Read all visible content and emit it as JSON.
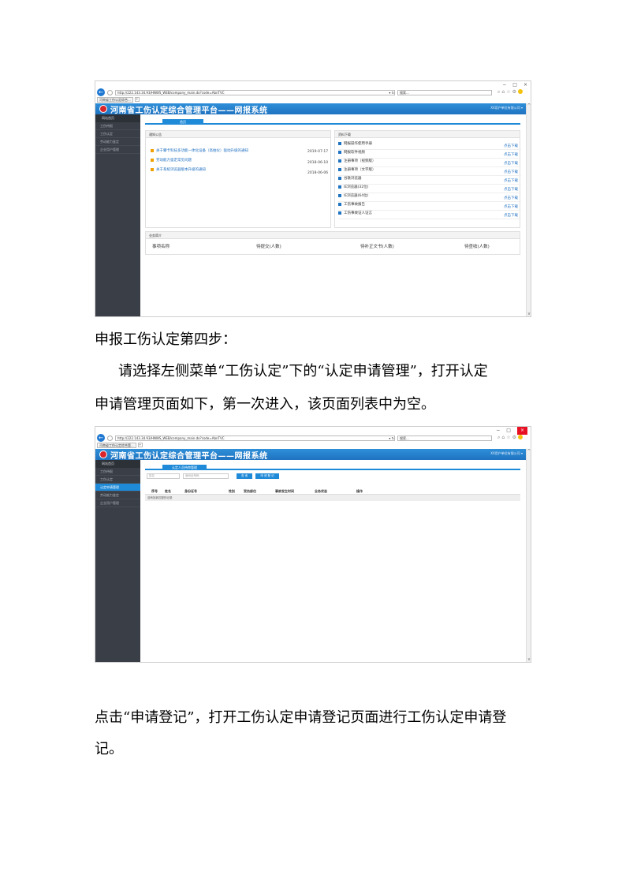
{
  "browser": {
    "url": "http://222.143.34.93/HNWS_WEB/company_main.do?code=AbnTVC",
    "search_placeholder": "搜索...",
    "tab_title_1": "河南省工伤认定综合...",
    "tab_title_2": "河南省工伤认定综合管...",
    "minimize": "−",
    "maximize": "□",
    "close": "×"
  },
  "app": {
    "title": "河南省工伤认定综合管理平台——网报系统",
    "user_1": "XX用户单位有限公司 ▾",
    "user_2": "XX用户单位有限公司 ▾"
  },
  "sidebar_1": {
    "home": "网站首页",
    "items": [
      "工伤待报",
      "工伤认定",
      "劳动能力鉴定",
      "企业用户管理"
    ]
  },
  "sidebar_2": {
    "home": "网站首页",
    "items": [
      "工伤待报",
      "工伤认定",
      "认定申请管理",
      "劳动能力鉴定",
      "企业用户管理"
    ]
  },
  "shot1": {
    "tab": "首页",
    "notice_title": "通知公告",
    "notices": [
      {
        "text": "关于攀卡科技多功能一体化设备（高拍仪）驱动升级的通知",
        "date": "2019-07-17"
      },
      {
        "text": "劳动能力鉴定常见问题",
        "date": "2018-06-10"
      },
      {
        "text": "关于系统浏览器版本升级的通知",
        "date": "2018-06-06"
      }
    ],
    "download_title": "资料下载",
    "downloads": [
      "网报操作使用手册",
      "网报软件视频",
      "注册事项（视频版）",
      "注册事项（文字版）",
      "谷歌浏览器",
      "IE浏览器(32位)",
      "IE浏览器(64位)",
      "工伤事故报告",
      "工伤事故证人证言"
    ],
    "download_link": "点击下载",
    "stats_title": "业务简介",
    "stats_cols": [
      "事项名称",
      "待提交(人数)",
      "待补正文书(人数)",
      "待查收(人数)"
    ]
  },
  "shot2": {
    "tab": "认定人员待审管理",
    "input_name": "姓名",
    "input_id": "身份证号码",
    "btn_query": "查 询",
    "btn_register": "申 请 登 记",
    "columns": [
      "序号",
      "姓名",
      "身份证号",
      "性别",
      "受伤部位",
      "事故发生时间",
      "业务状态",
      "操作"
    ],
    "empty_text": "没有找到匹配的记录"
  },
  "doc": {
    "step_heading": "申报工伤认定第四步：",
    "para1_line1": "请选择左侧菜单“工伤认定”下的“认定申请管理”，打开认定",
    "para1_line2": "申请管理页面如下，第一次进入，该页面列表中为空。",
    "para2_line1": "点击“申请登记”，打开工伤认定申请登记页面进行工伤认定申请登",
    "para2_line2": "记。"
  }
}
